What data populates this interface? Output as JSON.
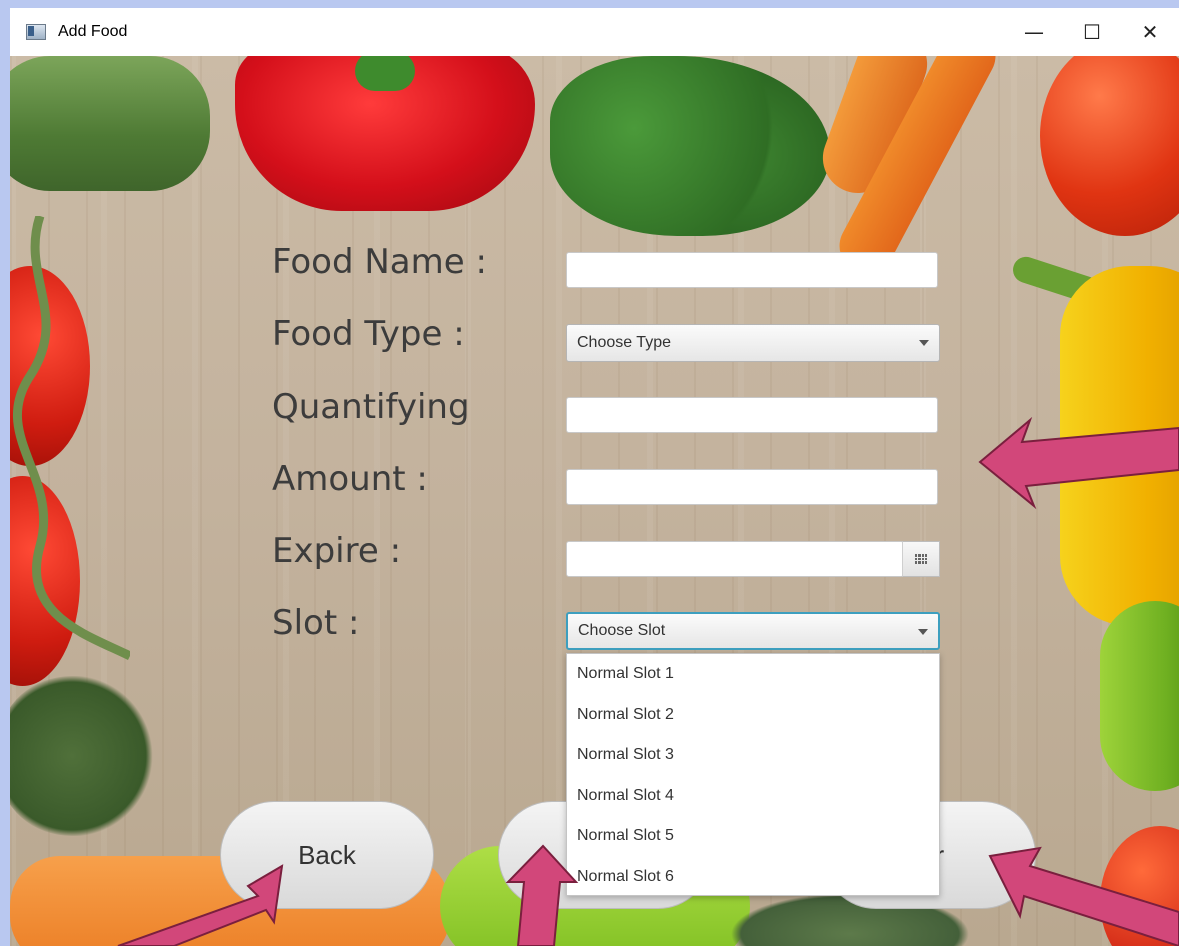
{
  "window": {
    "title": "Add Food",
    "minimize_glyph": "—",
    "maximize_glyph": "☐",
    "close_glyph": "✕"
  },
  "form": {
    "food_name_label": "Food Name :",
    "food_name_value": "",
    "food_type_label": "Food Type :",
    "food_type_value": "Choose Type",
    "quantifying_label": "Quantifying",
    "quantifying_value": "",
    "amount_label": "Amount :",
    "amount_value": "",
    "expire_label": "Expire :",
    "expire_value": "",
    "slot_label": "Slot :",
    "slot_value": "Choose Slot"
  },
  "slot_options": [
    "Normal Slot 1",
    "Normal Slot 2",
    "Normal Slot 3",
    "Normal Slot 4",
    "Normal Slot 5",
    "Normal Slot 6"
  ],
  "buttons": {
    "back_label": "Back",
    "clear_label_visible": "ar"
  },
  "annotation_color": "#d2477a"
}
